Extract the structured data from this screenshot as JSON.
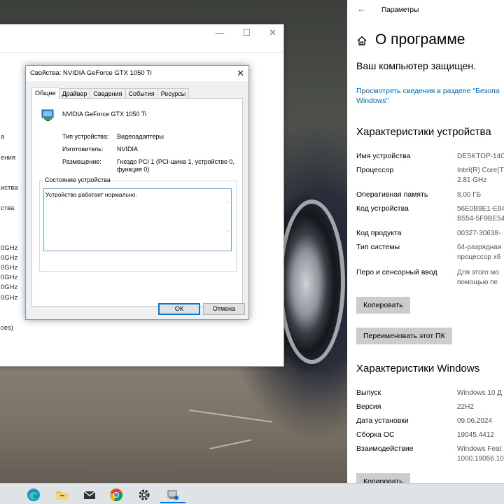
{
  "background_window": {
    "fragments": [
      "a",
      "ения",
      "иства",
      "ства",
      "0GHz",
      "0GHz",
      "0GHz",
      "0GHz",
      "0GHz",
      "0GHz",
      "ces)"
    ]
  },
  "dialog": {
    "title": "Свойства: NVIDIA GeForce GTX 1050 Ti",
    "tabs": [
      "Общие",
      "Драйвер",
      "Сведения",
      "События",
      "Ресурсы"
    ],
    "device_name": "NVIDIA GeForce GTX 1050 Ti",
    "properties": [
      {
        "label": "Тип устройства:",
        "value": "Видеоадаптеры"
      },
      {
        "label": "Изготовитель:",
        "value": "NVIDIA"
      },
      {
        "label": "Размещение:",
        "value": "Гнездо PCI 1 (PCI-шина 1, устройство 0, функция 0)"
      }
    ],
    "status_group_label": "Состояние устройства",
    "status_text": "Устройство работает нормально.",
    "ok_label": "ОК",
    "cancel_label": "Отмена"
  },
  "settings": {
    "app_title": "Параметры",
    "page_title": "О программе",
    "protected_text": "Ваш компьютер защищен.",
    "security_link": "Просмотреть сведения в разделе \"Безопасность Windows\"",
    "security_link_display": "Просмотреть сведения в разделе \"Безопа\nWindows\"",
    "device_specs_title": "Характеристики устройства",
    "device_specs": [
      {
        "label": "Имя устройства",
        "value": "DESKTOP-14C"
      },
      {
        "label": "Процессор",
        "value": "Intel(R) Core(T\n2.81 GHz"
      },
      {
        "label": "Оперативная память",
        "value": "8,00 ГБ"
      },
      {
        "label": "Код устройства",
        "value": "56E0B9E1-E84\nB554-5F9BE54"
      },
      {
        "label": "Код продукта",
        "value": "00327-30638-"
      },
      {
        "label": "Тип системы",
        "value": "64-разрядная\nпроцессор x6"
      },
      {
        "label": "Перо и сенсорный ввод",
        "value": "Для этого мо\nпомощью пе"
      }
    ],
    "copy_button": "Копировать",
    "rename_button": "Переименовать этот ПК",
    "windows_specs_title": "Характеристики Windows",
    "windows_specs": [
      {
        "label": "Выпуск",
        "value": "Windows 10 Д"
      },
      {
        "label": "Версия",
        "value": "22H2"
      },
      {
        "label": "Дата установки",
        "value": "09.06.2024"
      },
      {
        "label": "Сборка ОС",
        "value": "19045.4412"
      },
      {
        "label": "Взаимодействие",
        "value": "Windows Feat\n1000.19056.10"
      }
    ],
    "copy_button_2": "Копировать"
  },
  "taskbar": {
    "items": [
      "edge-icon",
      "file-explorer-icon",
      "mail-icon",
      "chrome-icon",
      "settings-gear-icon",
      "device-manager-icon"
    ]
  },
  "colors": {
    "accent": "#0078d7",
    "link": "#0067c0",
    "button_gray": "#cccccc"
  }
}
